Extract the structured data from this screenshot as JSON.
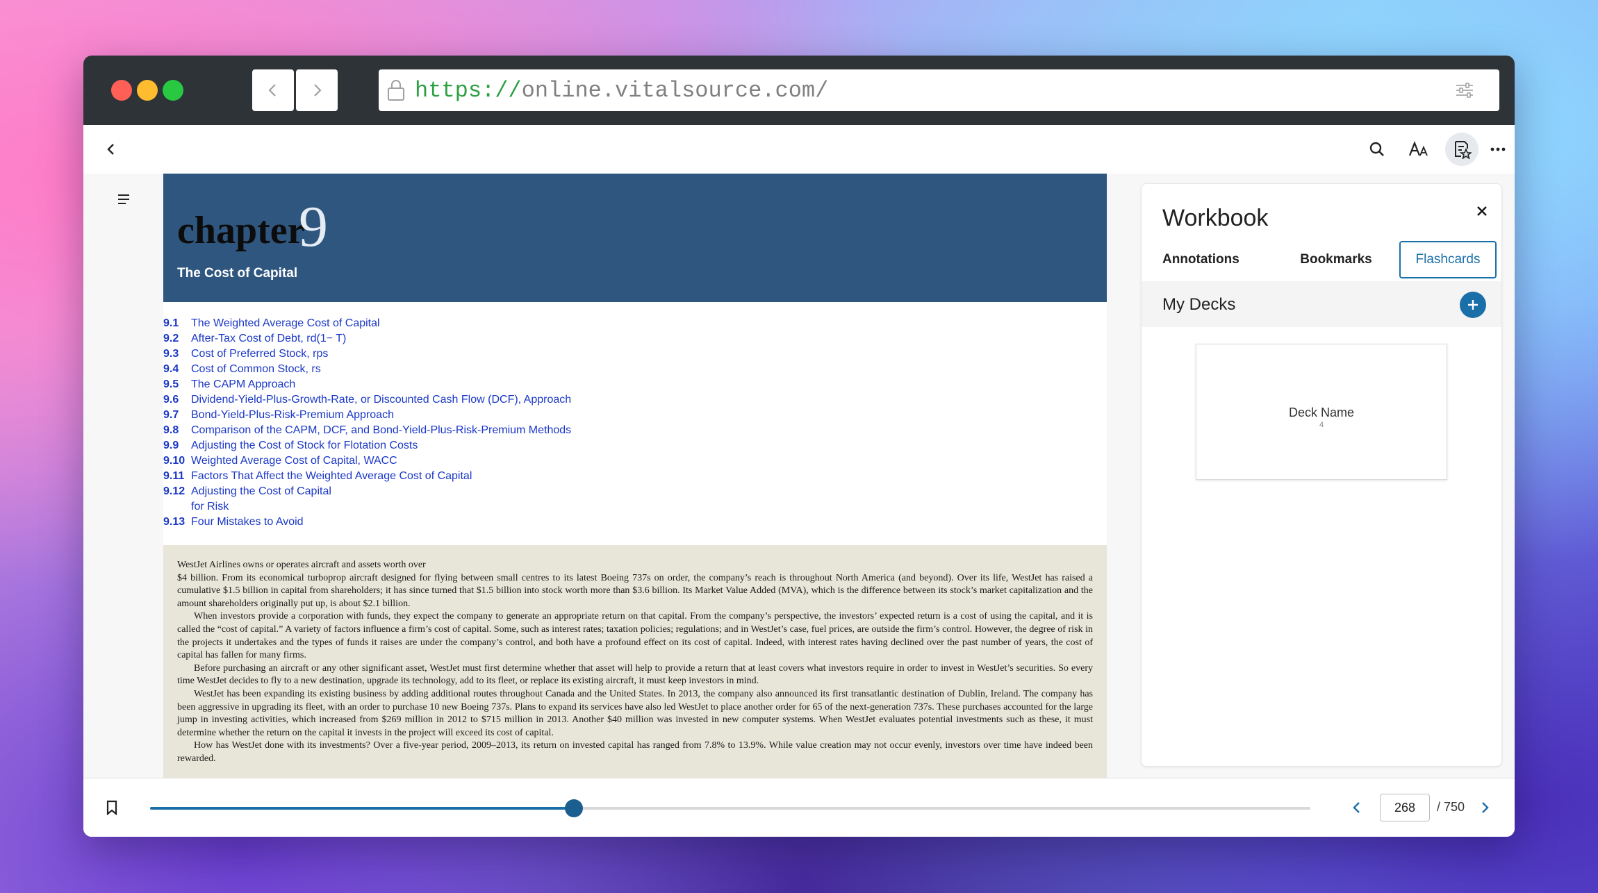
{
  "browser": {
    "url_scheme": "https://",
    "url_rest": "online.vitalsource.com/"
  },
  "book": {
    "chapter_word": "chapter",
    "chapter_number": "9",
    "chapter_title": "The Cost of Capital",
    "toc": [
      {
        "num": "9.1",
        "text": "The Weighted Average Cost of Capital"
      },
      {
        "num": "9.2",
        "text": "After-Tax Cost of Debt, rd(1− T)"
      },
      {
        "num": "9.3",
        "text": "Cost of Preferred Stock, rps"
      },
      {
        "num": "9.4",
        "text": "Cost of Common Stock, rs"
      },
      {
        "num": "9.5",
        "text": "The CAPM Approach"
      },
      {
        "num": "9.6",
        "text": "Dividend-Yield-Plus-Growth-Rate, or Discounted Cash Flow (DCF), Approach"
      },
      {
        "num": "9.7",
        "text": "Bond-Yield-Plus-Risk-Premium Approach"
      },
      {
        "num": "9.8",
        "text": "Comparison of the CAPM, DCF, and Bond-Yield-Plus-Risk-Premium Methods"
      },
      {
        "num": "9.9",
        "text": "Adjusting the Cost of Stock for Flotation Costs"
      },
      {
        "num": "9.10",
        "text": "Weighted Average Cost of Capital, WACC"
      },
      {
        "num": "9.11",
        "text": "Factors That Affect the Weighted Average Cost of Capital"
      },
      {
        "num": "9.12",
        "text": "Adjusting the Cost of Capital\nfor Risk"
      },
      {
        "num": "9.13",
        "text": "Four Mistakes to Avoid"
      }
    ],
    "intro_lead": "WestJet Airlines owns or operates aircraft and assets worth over",
    "intro_paragraphs": [
      "$4 billion. From its economical turboprop aircraft designed for flying between small centres to its latest Boeing 737s on order, the company’s reach is throughout North America (and beyond). Over its life, WestJet has raised a cumulative $1.5 billion in capital from shareholders; it has since turned that $1.5 billion into stock worth more than $3.6 billion. Its Market Value Added (MVA), which is the difference between its stock’s market capitalization and the amount shareholders originally put up, is about $2.1 billion.",
      "When investors provide a corporation with funds, they expect the company to generate an appropriate return on that capital. From the company’s perspective, the investors’ expected return is a cost of using the capital, and it is called the “cost of capital.” A variety of factors influence a firm’s cost of capital. Some, such as interest rates; taxation policies; regulations; and in WestJet’s case, fuel prices, are outside the firm’s control. However, the degree of risk in the projects it undertakes and the types of funds it raises are under the company’s control, and both have a profound effect on its cost of capital. Indeed, with interest rates having declined over the past number of years, the cost of capital has fallen for many firms.",
      "Before purchasing an aircraft or any other significant asset, WestJet must first determine whether that asset will help to provide a return that at least covers what investors require in order to invest in WestJet’s securities. So every time WestJet decides to fly to a new destination, upgrade its technology, add to its fleet, or replace its existing aircraft, it must keep investors in mind.",
      "WestJet has been expanding its existing business by adding additional routes throughout Canada and the United States. In 2013, the company also announced its first transatlantic destination of Dublin, Ireland. The company has been aggressive in upgrading its fleet, with an order to purchase 10 new Boeing 737s. Plans to expand its services have also led WestJet to place another order for 65 of the next-generation 737s. These purchases accounted for the large jump in investing activities, which increased from $269 million in 2012 to $715 million in 2013. Another $40 million was invested in new computer systems. When WestJet evaluates potential investments such as these, it must determine whether the return on the capital it invests in the project will exceed its cost of capital.",
      "How has WestJet done with its investments? Over a five-year period, 2009–2013, its return on invested capital has ranged from 7.8% to 13.9%. While value creation may not occur evenly, investors over time have indeed been rewarded."
    ]
  },
  "workbook": {
    "title": "Workbook",
    "tabs": {
      "annotations": "Annotations",
      "bookmarks": "Bookmarks",
      "flashcards": "Flashcards"
    },
    "active_tab": "Flashcards",
    "decks_title": "My Decks",
    "deck": {
      "name": "Deck Name",
      "count": "4"
    }
  },
  "footer": {
    "current_page": "268",
    "total_pages": "/ 750",
    "progress_fraction": 0.365
  },
  "colors": {
    "accent": "#1a6fa8",
    "chapter_banner": "#2f567f",
    "toc_link": "#1a37c7",
    "intro_box": "#e8e6d8"
  },
  "icons": [
    "back-arrow-icon",
    "forward-arrow-icon",
    "lock-icon",
    "sliders-icon",
    "chevron-left-icon",
    "search-icon",
    "text-size-icon",
    "workbook-icon",
    "more-icon",
    "menu-icon",
    "close-icon",
    "plus-icon",
    "bookmark-icon",
    "chevron-right-icon"
  ]
}
